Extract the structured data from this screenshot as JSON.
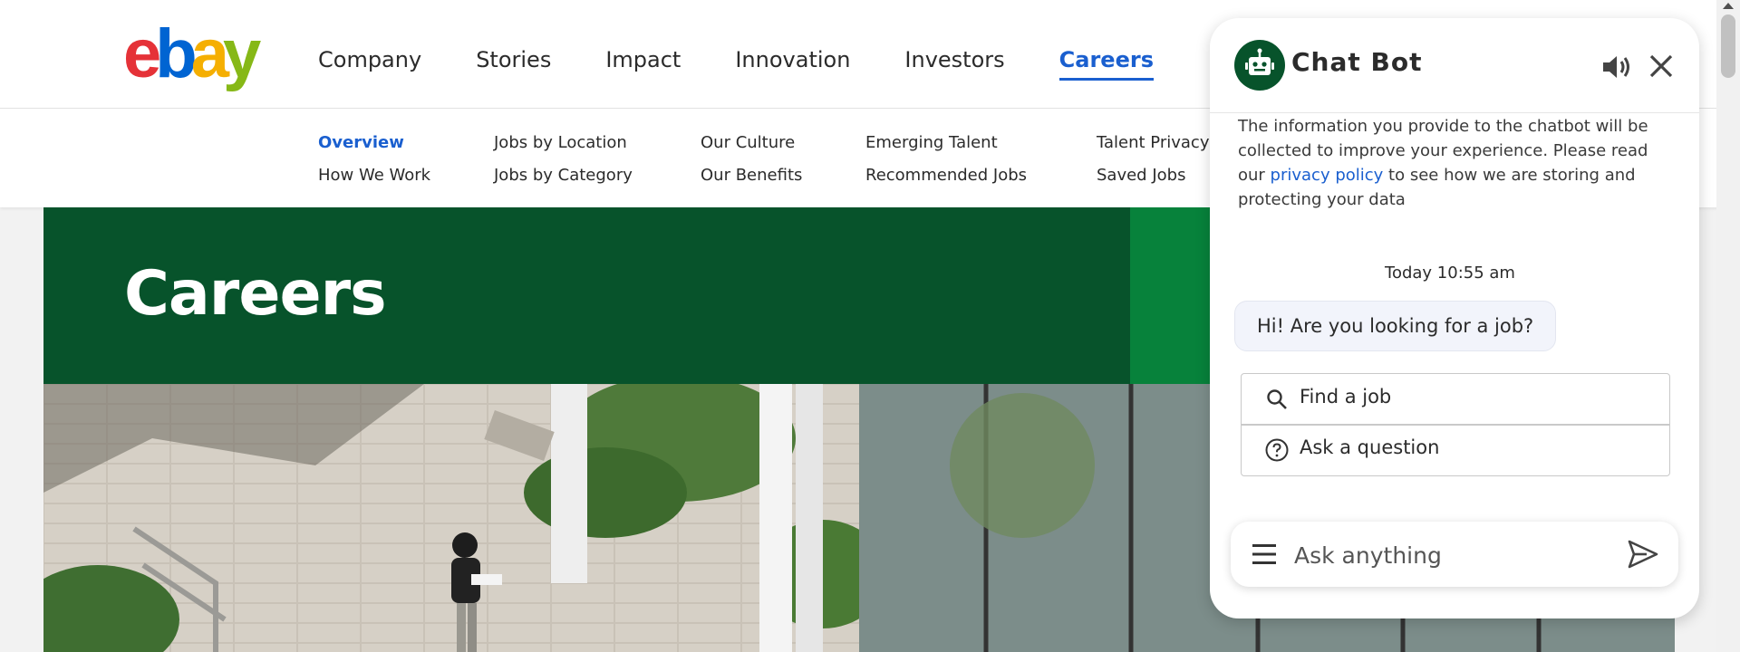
{
  "header": {
    "logo_letters": [
      {
        "char": "e",
        "color": "#e53238"
      },
      {
        "char": "b",
        "color": "#0064d2"
      },
      {
        "char": "a",
        "color": "#f5af02"
      },
      {
        "char": "y",
        "color": "#86b817"
      }
    ],
    "nav": [
      {
        "label": "Company",
        "active": false
      },
      {
        "label": "Stories",
        "active": false
      },
      {
        "label": "Impact",
        "active": false
      },
      {
        "label": "Innovation",
        "active": false
      },
      {
        "label": "Investors",
        "active": false
      },
      {
        "label": "Careers",
        "active": true
      }
    ]
  },
  "subnav": {
    "columns": [
      [
        "Overview",
        "How We Work"
      ],
      [
        "Jobs by Location",
        "Jobs by Category"
      ],
      [
        "Our Culture",
        "Our Benefits"
      ],
      [
        "Emerging Talent",
        "Recommended Jobs"
      ],
      [
        "Talent Privacy N",
        "Saved Jobs"
      ]
    ],
    "active": "Overview"
  },
  "hero": {
    "title": "Careers",
    "band_color": "#07532b",
    "accent_color": "#07823b"
  },
  "chat": {
    "title": "Chat Bot",
    "disclaimer_before": "The information you provide to the chatbot will be collected to improve your experience. Please read our ",
    "privacy_link": "privacy policy",
    "disclaimer_after": " to see how we are storing and protecting your data",
    "timestamp": "Today 10:55 am",
    "bot_message": "Hi! Are you looking for a job?",
    "options": [
      {
        "label": "Find a job",
        "icon": "search-icon"
      },
      {
        "label": "Ask a question",
        "icon": "question-circle-icon"
      }
    ],
    "input_placeholder": "Ask anything"
  },
  "colors": {
    "accent": "#1a5fcf",
    "brand_green": "#07532b"
  }
}
